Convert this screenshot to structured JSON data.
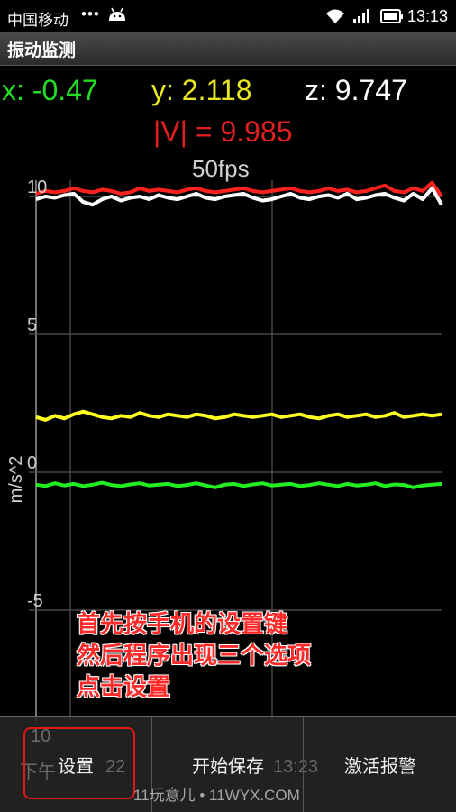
{
  "status_bar": {
    "carrier": "中国移动",
    "dots": "•••",
    "time": "13:13",
    "icons": [
      "android-icon",
      "wifi-icon",
      "signal-icon",
      "battery-icon"
    ]
  },
  "app": {
    "title": "振动监测"
  },
  "readouts": {
    "x": "x: -0.47",
    "y": "y: 2.118",
    "z": "z: 9.747",
    "v": "|V| = 9.985",
    "fps": "50fps"
  },
  "chart_data": {
    "type": "line",
    "ylabel": "m/s^2",
    "ylim": [
      -8.5,
      10.6
    ],
    "yticks": [
      "10",
      "5",
      "0",
      "-5"
    ],
    "grid": true,
    "series": [
      {
        "color": "#ff2020",
        "values": [
          10.1,
          10.2,
          10.15,
          10.2,
          10.3,
          10.2,
          10.15,
          10.25,
          10.2,
          10.1,
          10.15,
          10.3,
          10.2,
          10.25,
          10.2,
          10.15,
          10.25,
          10.3,
          10.2,
          10.15,
          10.2,
          10.25,
          10.3,
          10.2,
          10.15,
          10.2,
          10.25,
          10.3,
          10.2,
          10.15,
          10.2,
          10.3,
          10.2,
          10.25,
          10.15,
          10.2,
          10.3,
          10.4,
          10.2,
          10.15,
          10.3,
          10.2,
          10.5,
          10.0
        ]
      },
      {
        "color": "#ffffff",
        "values": [
          9.9,
          10.0,
          9.95,
          10.05,
          10.1,
          9.8,
          9.7,
          9.9,
          10.0,
          9.85,
          9.95,
          10.0,
          9.9,
          10.05,
          9.95,
          9.9,
          10.0,
          10.1,
          9.95,
          9.9,
          10.0,
          10.05,
          10.1,
          9.95,
          9.85,
          9.9,
          10.0,
          10.1,
          9.95,
          9.9,
          10.0,
          10.05,
          9.95,
          10.1,
          9.9,
          9.95,
          10.05,
          10.1,
          9.95,
          9.85,
          10.1,
          9.9,
          10.3,
          9.7
        ]
      },
      {
        "color": "#ffff20",
        "values": [
          2.0,
          1.9,
          2.05,
          1.95,
          2.1,
          2.2,
          2.1,
          2.0,
          1.95,
          2.05,
          2.0,
          2.15,
          2.05,
          2.0,
          2.1,
          2.05,
          2.0,
          2.1,
          2.05,
          1.95,
          2.0,
          2.1,
          2.05,
          2.0,
          2.05,
          2.1,
          2.0,
          2.05,
          2.1,
          2.0,
          1.95,
          2.05,
          2.1,
          2.0,
          2.05,
          2.1,
          2.0,
          2.05,
          2.15,
          2.0,
          2.05,
          2.1,
          2.05,
          2.1
        ]
      },
      {
        "color": "#22ee22",
        "values": [
          -0.45,
          -0.5,
          -0.4,
          -0.48,
          -0.42,
          -0.5,
          -0.45,
          -0.38,
          -0.46,
          -0.5,
          -0.44,
          -0.4,
          -0.48,
          -0.45,
          -0.42,
          -0.5,
          -0.46,
          -0.4,
          -0.48,
          -0.55,
          -0.45,
          -0.42,
          -0.5,
          -0.44,
          -0.4,
          -0.48,
          -0.45,
          -0.42,
          -0.5,
          -0.46,
          -0.4,
          -0.45,
          -0.5,
          -0.42,
          -0.48,
          -0.45,
          -0.4,
          -0.5,
          -0.44,
          -0.46,
          -0.55,
          -0.48,
          -0.45,
          -0.42
        ]
      }
    ]
  },
  "annotation": {
    "lines": [
      "首先按手机的设置键",
      "然后程序出现三个选项",
      "点击设置"
    ]
  },
  "menu": {
    "settings": "设置",
    "start_save": "开始保存",
    "activate_alarm": "激活报警"
  },
  "background_ghost": {
    "x_label": "10",
    "left_text": "下午",
    "mid_time": "22",
    "right_time": "13:23"
  },
  "watermark": "11玩意儿 • 11WYX.COM"
}
